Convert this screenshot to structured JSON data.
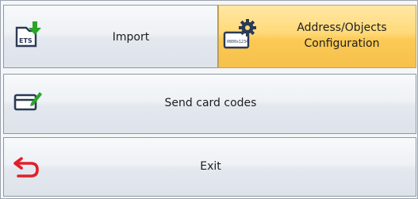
{
  "buttons": {
    "import": {
      "label": "Import",
      "icon": "ets-import-icon"
    },
    "address_objects": {
      "line1": "Address/Objects",
      "line2": "Configuration",
      "icon": "address-config-icon",
      "selected": true
    },
    "send_card_codes": {
      "label": "Send card codes",
      "icon": "card-edit-icon"
    },
    "exit": {
      "label": "Exit",
      "icon": "exit-arrow-icon"
    }
  },
  "icon_texts": {
    "ets": "ETS",
    "code": "0800x1234"
  },
  "colors": {
    "active_bg": "#fbca55",
    "button_bg": "#e3e8ee",
    "green_arrow": "#2aa52a",
    "exit_red": "#e0202a"
  }
}
